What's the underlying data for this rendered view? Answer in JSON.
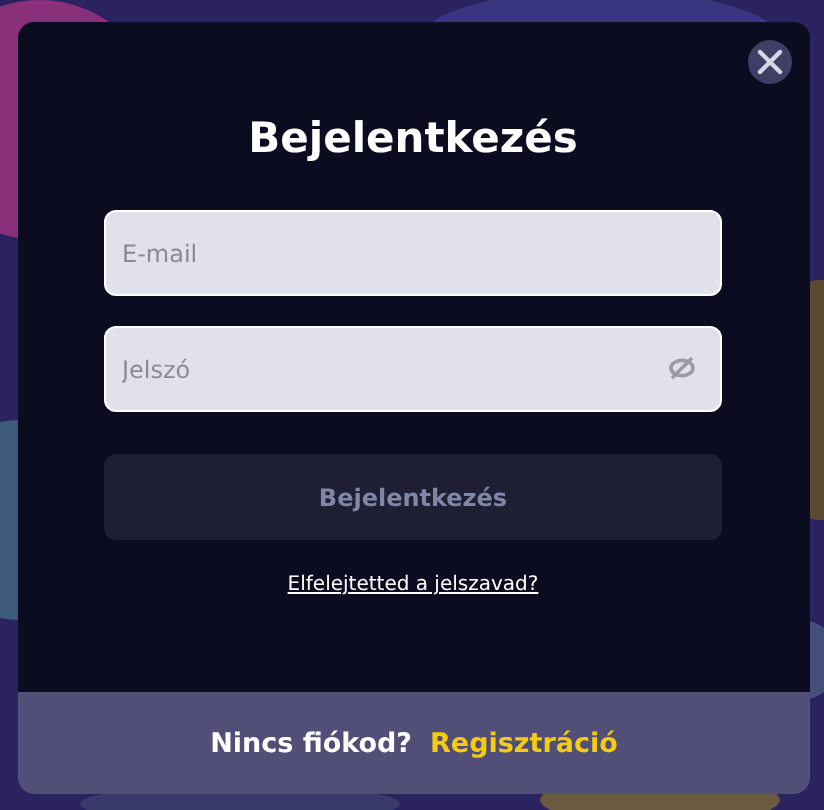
{
  "title": "Bejelentkezés",
  "email": {
    "placeholder": "E-mail"
  },
  "password": {
    "placeholder": "Jelszó"
  },
  "submit": {
    "label": "Bejelentkezés",
    "disabled": true
  },
  "forgot_link": "Elfelejtetted a jelszavad?",
  "footer": {
    "text": "Nincs fiókod?",
    "link": "Regisztráció"
  }
}
